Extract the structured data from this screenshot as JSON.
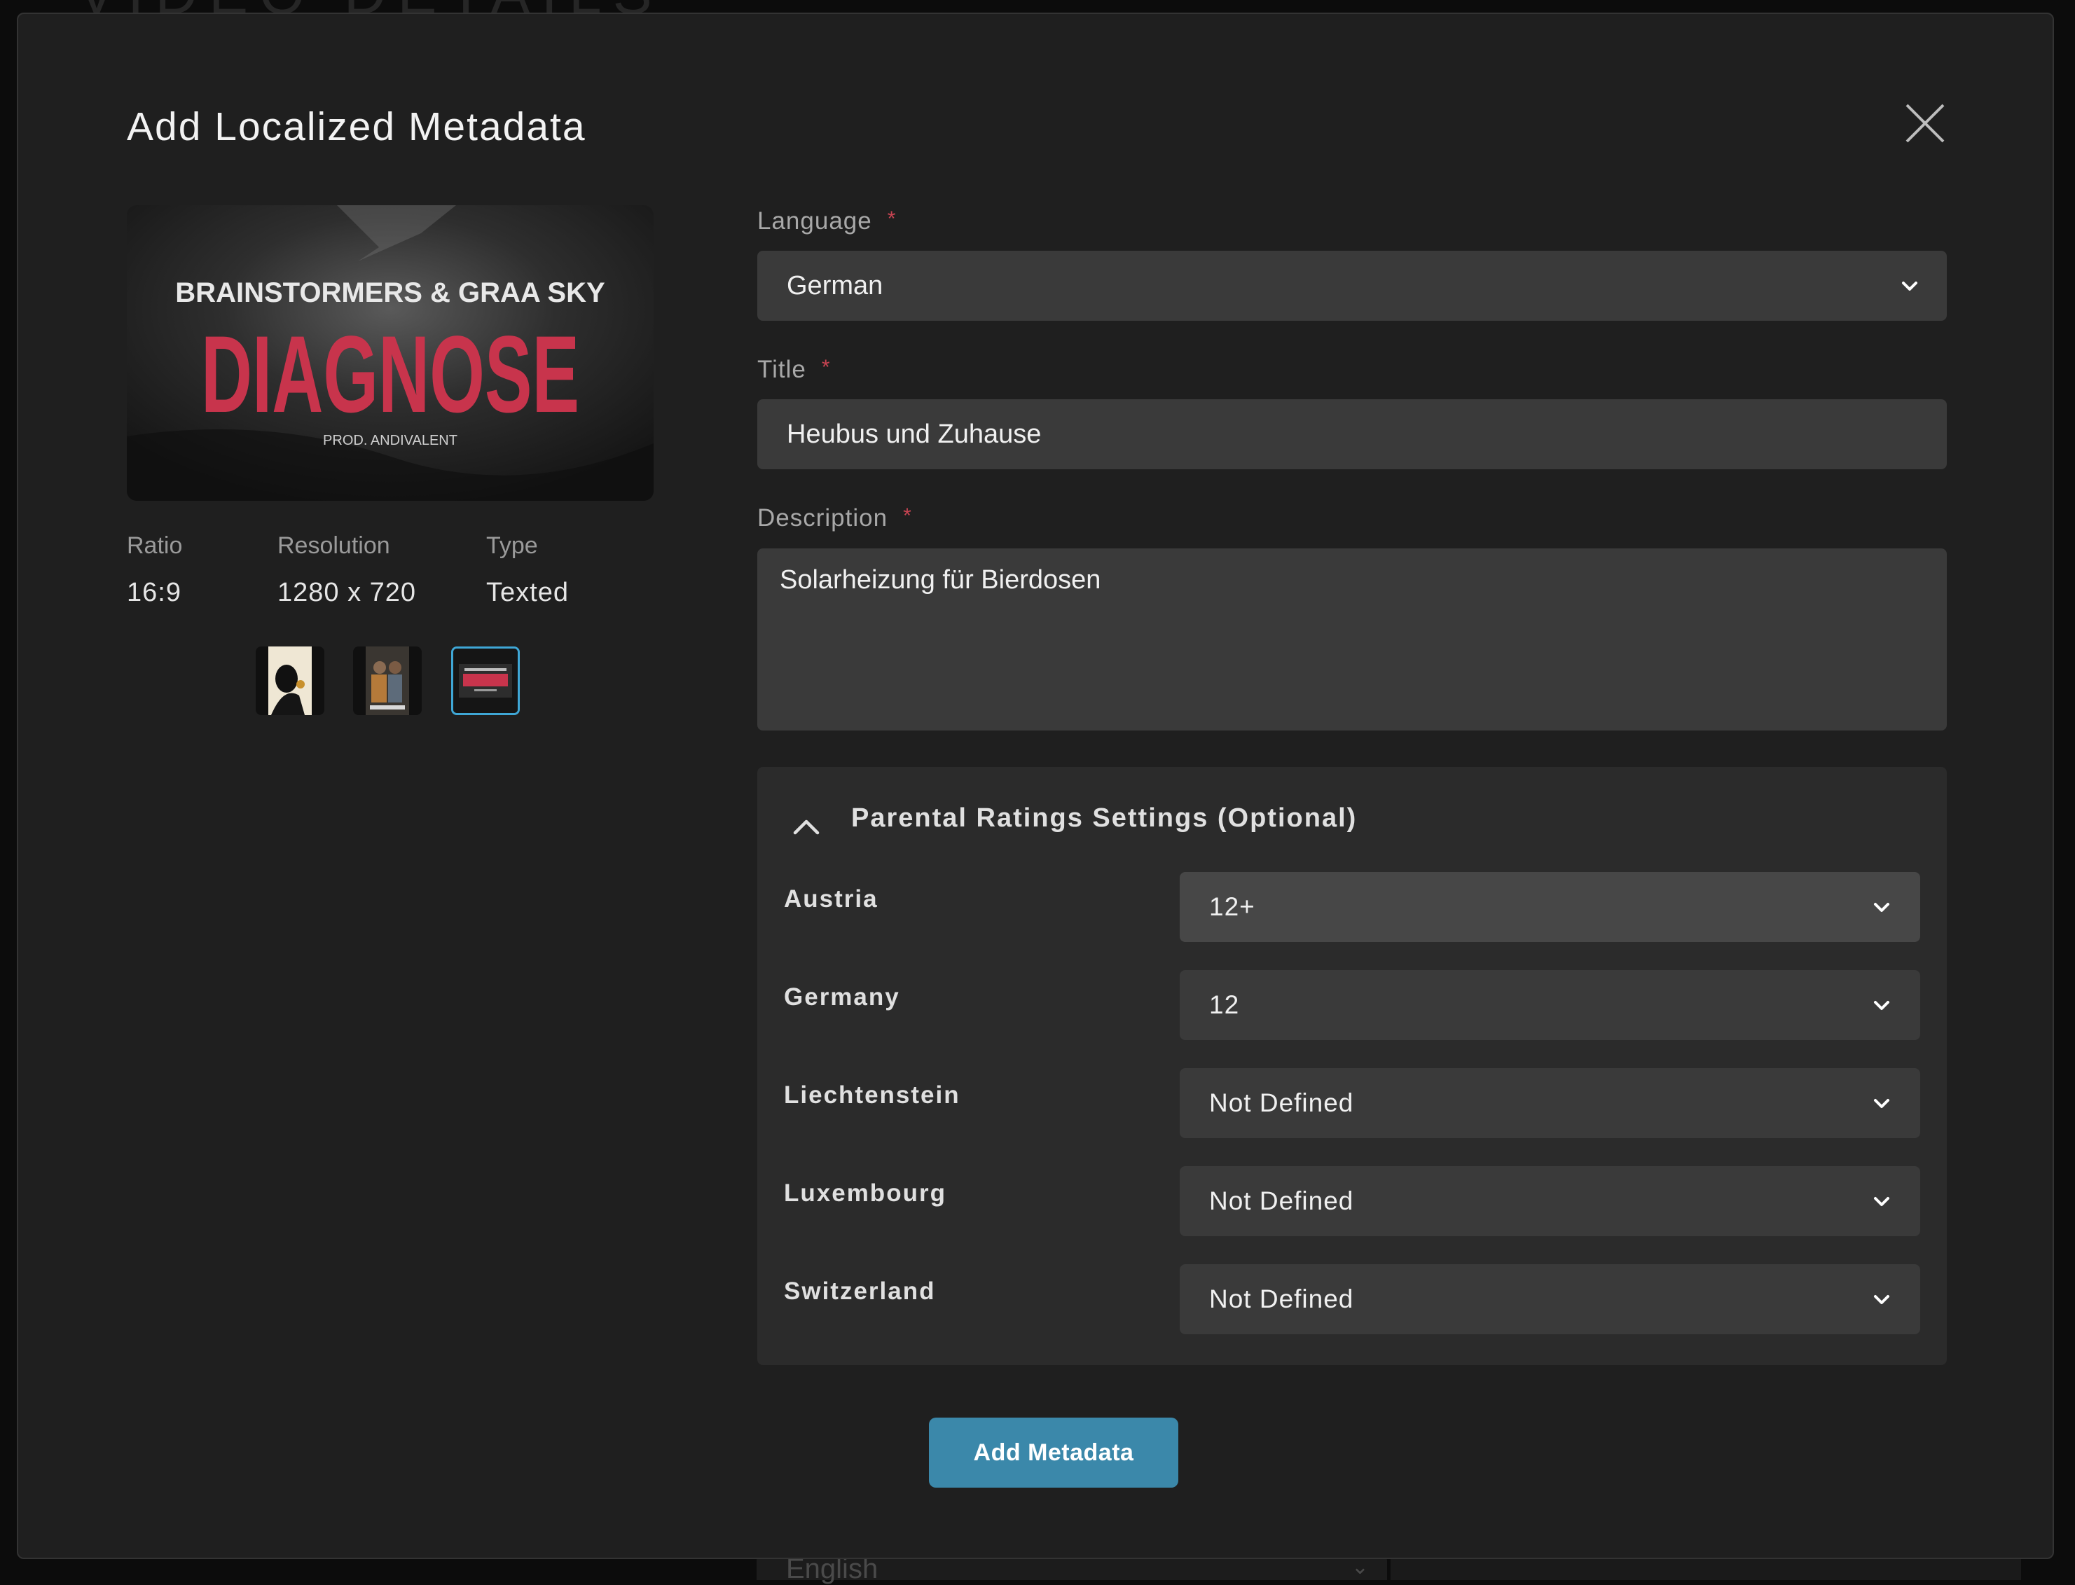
{
  "background": {
    "page_title": "VIDEO DETAILS",
    "language_value": "English"
  },
  "modal": {
    "title": "Add Localized Metadata",
    "preview": {
      "artist": "BRAINSTORMERS & GRAA SKY",
      "album_title": "DIAGNOSE",
      "producer": "PROD. ANDIVALENT"
    },
    "meta": {
      "ratio_label": "Ratio",
      "ratio_value": "16:9",
      "resolution_label": "Resolution",
      "resolution_value": "1280 x 720",
      "type_label": "Type",
      "type_value": "Texted"
    },
    "thumbnails": [
      {
        "name": "thumbnail-1",
        "selected": false
      },
      {
        "name": "thumbnail-2",
        "selected": false
      },
      {
        "name": "thumbnail-3",
        "selected": true
      }
    ],
    "form": {
      "language_label": "Language",
      "language_value": "German",
      "title_label": "Title",
      "title_value": "Heubus und Zuhause",
      "description_label": "Description",
      "description_value": "Solarheizung für Bierdosen",
      "required_mark": "*"
    },
    "ratings": {
      "title": "Parental Ratings Settings (Optional)",
      "rows": [
        {
          "country": "Austria",
          "value": "12+"
        },
        {
          "country": "Germany",
          "value": "12"
        },
        {
          "country": "Liechtenstein",
          "value": "Not Defined"
        },
        {
          "country": "Luxembourg",
          "value": "Not Defined"
        },
        {
          "country": "Switzerland",
          "value": "Not Defined"
        }
      ]
    },
    "submit_label": "Add Metadata"
  },
  "colors": {
    "accent": "#3b88aa",
    "required": "#c94452",
    "selected_thumb_border": "#3fa7d6",
    "modal_bg": "#1f1f1f",
    "input_bg": "#3a3a3a"
  },
  "icons": [
    "close-icon",
    "chevron-down-icon",
    "chevron-up-icon"
  ]
}
